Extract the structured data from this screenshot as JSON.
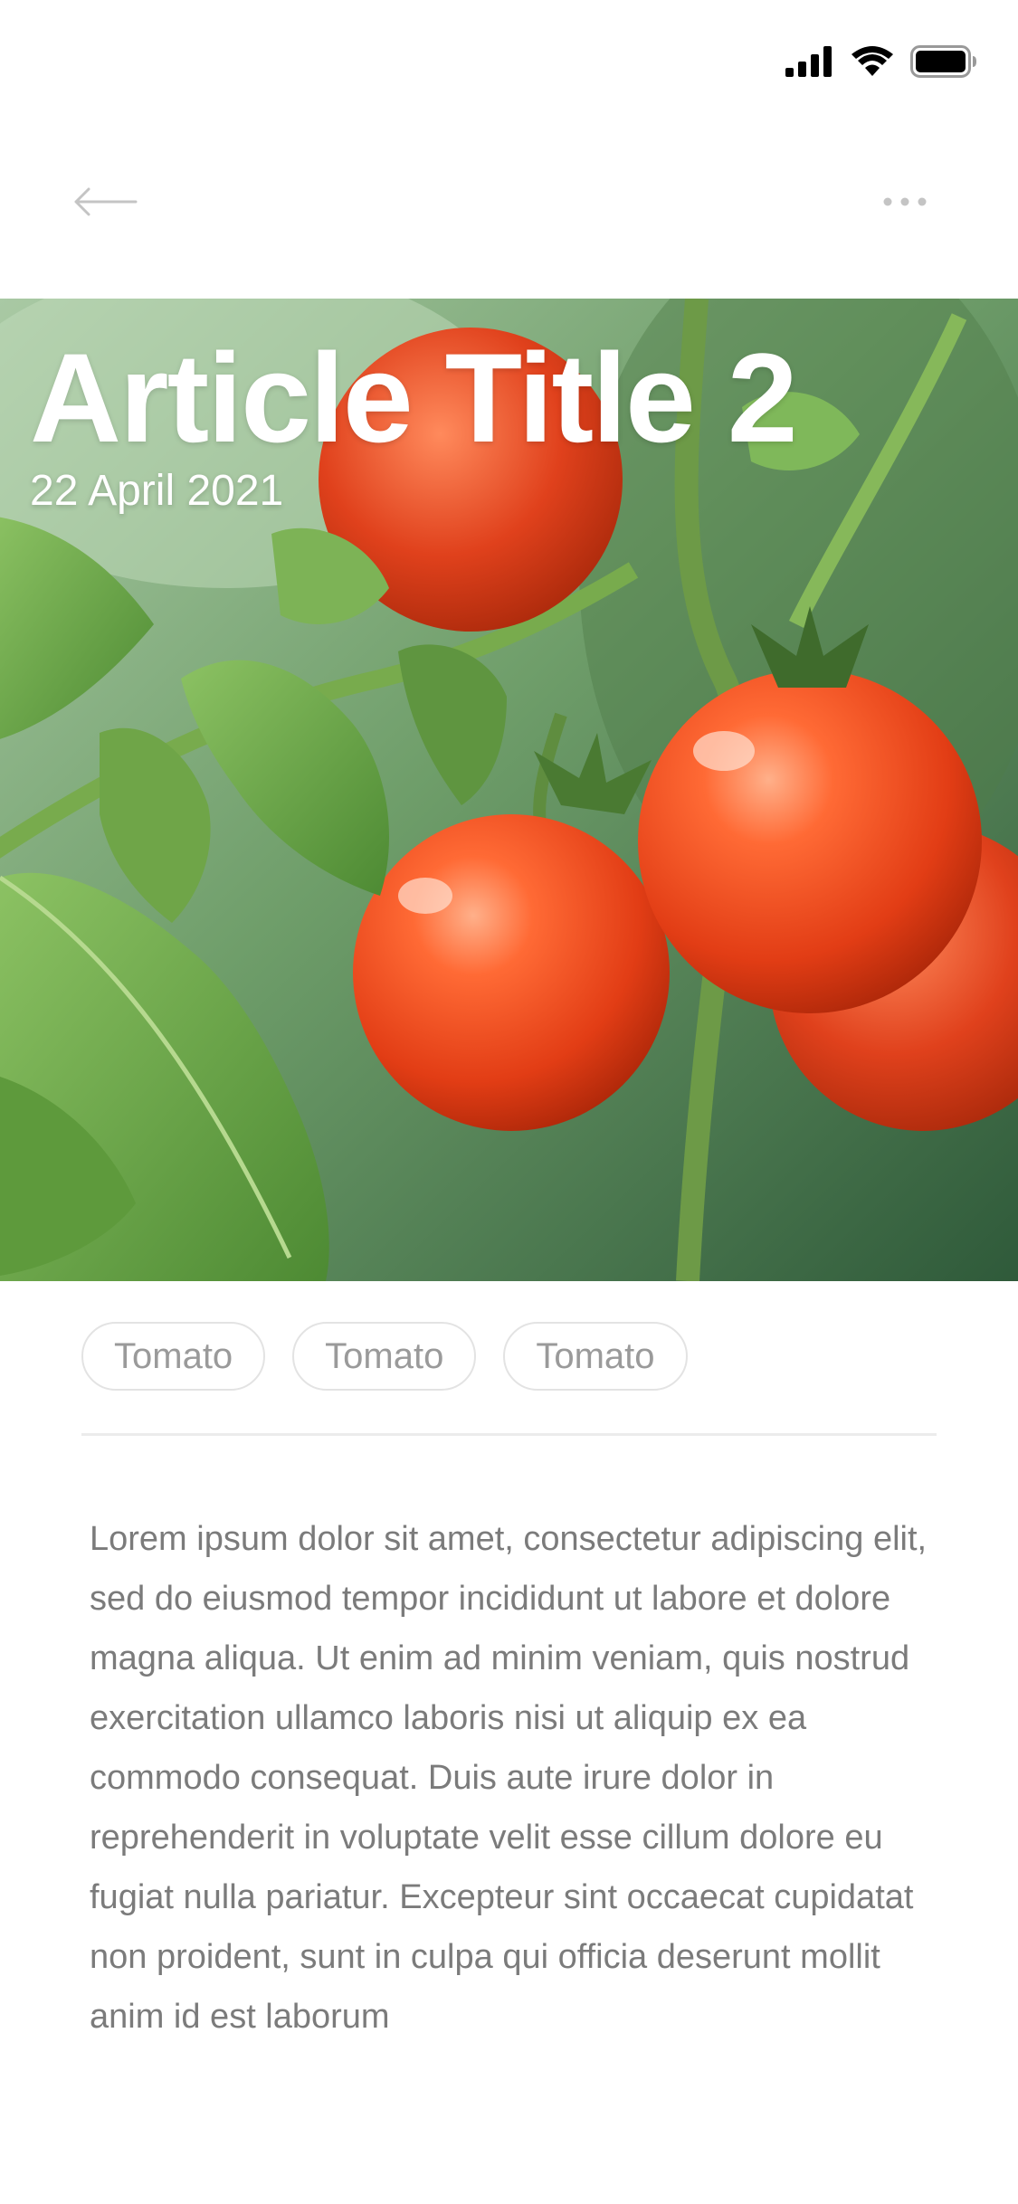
{
  "status_bar": {
    "icons": [
      "signal-icon",
      "wifi-icon",
      "battery-icon"
    ]
  },
  "nav": {
    "back_icon": "arrow-left-icon",
    "more_icon": "more-dots-icon"
  },
  "article": {
    "title": "Article Title 2",
    "date": "22 April 2021",
    "tags": [
      "Tomato",
      "Tomato",
      "Tomato"
    ],
    "body": "Lorem ipsum dolor sit amet, consectetur adipiscing elit, sed do eiusmod tempor incididunt ut labore et dolore magna aliqua. Ut enim ad minim veniam, quis nostrud exercitation ullamco laboris nisi ut aliquip ex ea commodo consequat. Duis aute irure dolor in reprehenderit in voluptate velit esse cillum dolore eu fugiat nulla pariatur. Excepteur sint occaecat cupidatat non proident, sunt in culpa qui officia deserunt mollit anim id est laborum"
  },
  "colors": {
    "text_body": "#7b7b7b",
    "tag_text": "#9a9a9a",
    "tag_border": "#e3e3e3",
    "divider": "#ececec",
    "icon_light": "#c4c4c4",
    "tomato": "#e8401c",
    "leaf": "#5e9a3c"
  }
}
